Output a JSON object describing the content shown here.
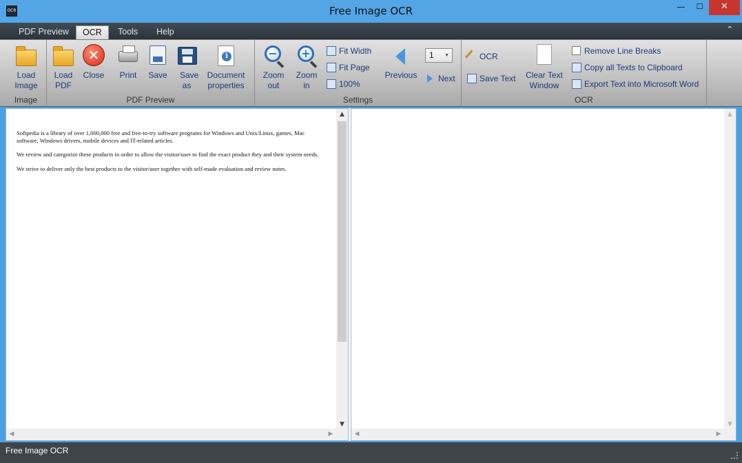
{
  "window": {
    "title": "Free Image OCR",
    "icon_label": "OCR",
    "minimize": "—",
    "maximize": "☐",
    "close": "✕"
  },
  "tabs": [
    {
      "label": "PDF Preview",
      "active": false
    },
    {
      "label": "OCR",
      "active": true
    },
    {
      "label": "Tools",
      "active": false
    },
    {
      "label": "Help",
      "active": false
    }
  ],
  "ribbon": {
    "image_group": {
      "label": "Image",
      "load_image": "Load Image"
    },
    "pdf_group": {
      "label": "PDF Preview",
      "load_pdf": "Load PDF",
      "close": "Close",
      "print": "Print",
      "save": "Save",
      "save_as": "Save as",
      "document_properties": "Document properties"
    },
    "settings_group": {
      "label": "Settings",
      "zoom_out": "Zoom out",
      "zoom_in": "Zoom in",
      "fit_width": "Fit Width",
      "fit_page": "Fit Page",
      "hundred": "100%",
      "previous": "Previous",
      "next": "Next",
      "page": "1"
    },
    "ocr_group": {
      "label": "OCR",
      "ocr": "OCR",
      "save_text": "Save Text",
      "clear_text_window": "Clear Text Window",
      "remove_line_breaks": "Remove Line Breaks",
      "copy_all": "Copy all Texts to Clipboard",
      "export_word": "Export Text into Microsoft Word"
    }
  },
  "document": {
    "paragraphs": [
      "Softpedia is a library of over 1,000,000 free and free-to-try software programs for Windows and Unix/Linux, games, Mac software, Windows drivers, mobile devices and IT-related articles.",
      "We review and categorize these products in order to allow the visitor/user to find the exact product they and their system needs.",
      "We strive to deliver only the best products to the visitor/user together with self-made evaluation and review notes."
    ]
  },
  "statusbar": {
    "text": "Free Image OCR"
  }
}
